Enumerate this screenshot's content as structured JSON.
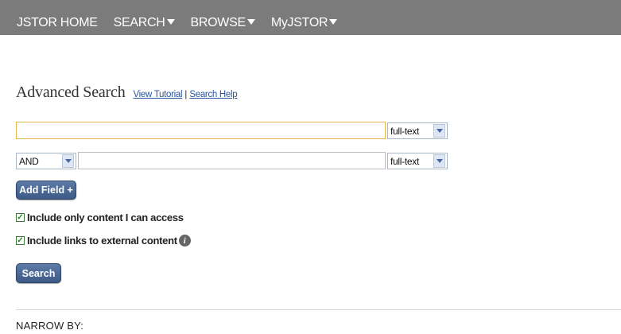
{
  "nav": {
    "items": [
      {
        "label": "JSTOR HOME",
        "dropdown": false
      },
      {
        "label": "SEARCH",
        "dropdown": true
      },
      {
        "label": "BROWSE",
        "dropdown": true
      },
      {
        "label": "MyJSTOR",
        "dropdown": true
      }
    ]
  },
  "heading": {
    "title": "Advanced Search",
    "tutorial_link": "View Tutorial",
    "separator": "|",
    "help_link": "Search Help"
  },
  "search": {
    "row1": {
      "value": "",
      "field_option": "full-text"
    },
    "row2": {
      "operator": "AND",
      "value": "",
      "field_option": "full-text"
    },
    "add_field_label": "Add Field +",
    "include_accessible_label": "Include only content I can access",
    "include_accessible_checked": true,
    "include_external_label": "Include links to external content",
    "include_external_checked": true,
    "search_button_label": "Search"
  },
  "narrow_by_label": "NARROW BY:",
  "colors": {
    "nav_bg": "#7b7b7b",
    "button": "#4a6794",
    "link": "#2a55a0",
    "focus_border": "#e8b84f"
  }
}
